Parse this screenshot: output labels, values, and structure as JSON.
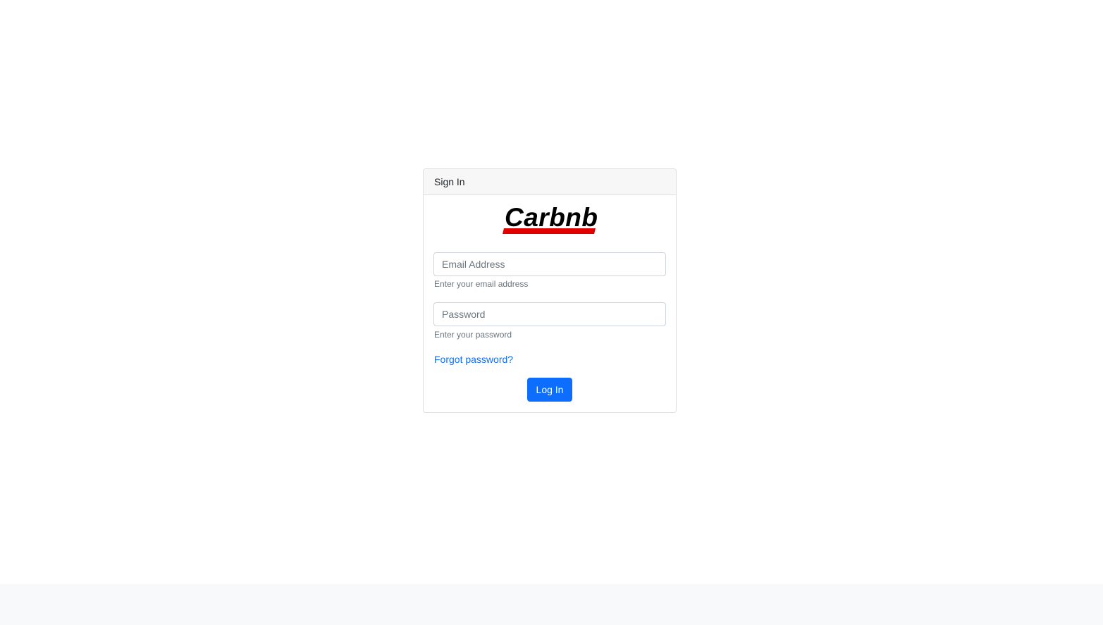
{
  "card": {
    "header_title": "Sign In"
  },
  "logo": {
    "text": "Carbnb",
    "accent_color": "#e00000"
  },
  "form": {
    "email": {
      "placeholder": "Email Address",
      "value": "",
      "help": "Enter your email address"
    },
    "password": {
      "placeholder": "Password",
      "value": "",
      "help": "Enter your password"
    },
    "forgot_label": "Forgot password?",
    "submit_label": "Log In"
  },
  "colors": {
    "primary": "#0d6efd",
    "header_bg": "#f7f7f7",
    "footer_bg": "#f8f9fa"
  }
}
